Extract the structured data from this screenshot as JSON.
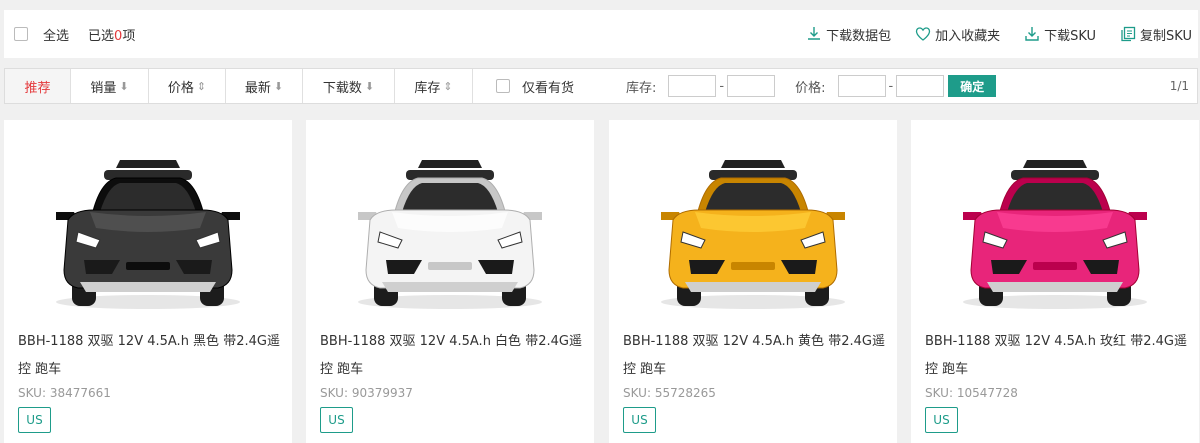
{
  "toolbar": {
    "select_all": "全选",
    "selected_prefix": "已选",
    "selected_count": "0",
    "selected_suffix": "项",
    "actions": [
      {
        "label": "下载数据包",
        "icon": "download-package-icon"
      },
      {
        "label": "加入收藏夹",
        "icon": "heart-icon"
      },
      {
        "label": "下载SKU",
        "icon": "download-icon"
      },
      {
        "label": "复制SKU",
        "icon": "copy-icon"
      }
    ]
  },
  "sort": {
    "options": [
      {
        "label": "推荐",
        "arrow": ""
      },
      {
        "label": "销量",
        "arrow": "⬇"
      },
      {
        "label": "价格",
        "arrow": "⇕"
      },
      {
        "label": "最新",
        "arrow": "⬇"
      },
      {
        "label": "下载数",
        "arrow": "⬇"
      },
      {
        "label": "库存",
        "arrow": "⇕"
      }
    ],
    "in_stock_label": "仅看有货",
    "stock_label": "库存:",
    "price_label": "价格:",
    "dash": "-",
    "confirm_label": "确定",
    "pager": "1/1"
  },
  "products": [
    {
      "title": "BBH-1188 双驱 12V 4.5A.h 黑色 带2.4G遥控 跑车",
      "sku_label": "SKU:",
      "sku": "38477661",
      "tag": "US",
      "color": "#3a3a3a"
    },
    {
      "title": "BBH-1188 双驱 12V 4.5A.h 白色 带2.4G遥控 跑车",
      "sku_label": "SKU:",
      "sku": "90379937",
      "tag": "US",
      "color": "#f4f4f4"
    },
    {
      "title": "BBH-1188 双驱 12V 4.5A.h 黄色 带2.4G遥控 跑车",
      "sku_label": "SKU:",
      "sku": "55728265",
      "tag": "US",
      "color": "#f5b21c"
    },
    {
      "title": "BBH-1188 双驱 12V 4.5A.h 玫红 带2.4G遥控 跑车",
      "sku_label": "SKU:",
      "sku": "10547728",
      "tag": "US",
      "color": "#e8257a"
    }
  ],
  "colors": {
    "accent": "#1e9c8a",
    "active_sort": "#e4393c"
  }
}
